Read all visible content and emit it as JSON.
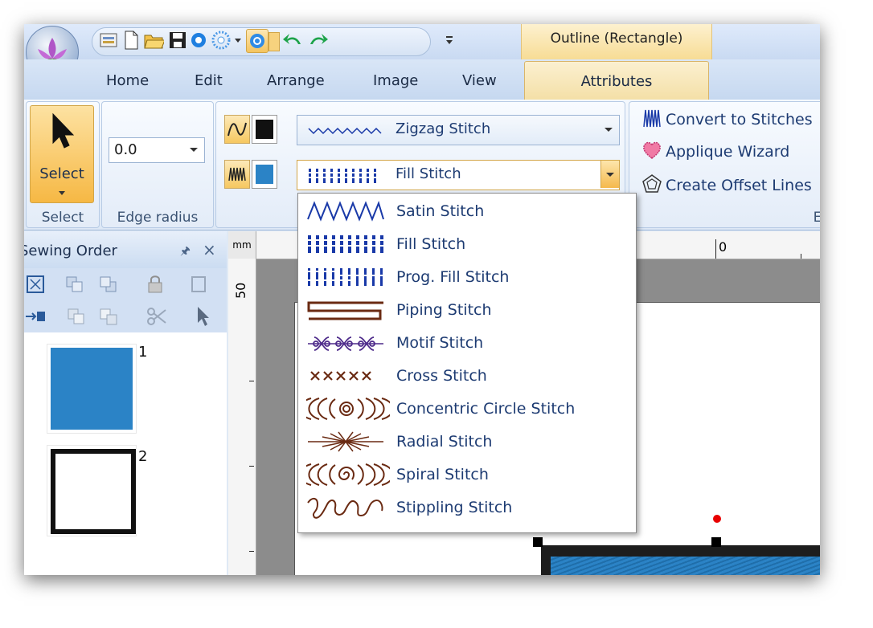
{
  "context_tab": {
    "title": "Outline (Rectangle)"
  },
  "tabs": [
    "Home",
    "Edit",
    "Arrange",
    "Image",
    "View",
    "Attributes"
  ],
  "ribbon": {
    "select": {
      "button_label": "Select",
      "group_label": "Select"
    },
    "edge_radius": {
      "value": "0.0",
      "group_label": "Edge radius"
    },
    "stitch": {
      "line_stitch_value": "Zigzag Stitch",
      "region_stitch_value": "Fill Stitch",
      "line_color": "#111111",
      "region_color": "#2b83c6"
    },
    "tools": {
      "convert_label": "Convert to Stitches",
      "applique_label": "Applique Wizard",
      "offset_label": "Create Offset Lines",
      "group_label_fragment": "E"
    }
  },
  "panel": {
    "title": "Sewing Order",
    "items": [
      {
        "number": "1"
      },
      {
        "number": "2"
      }
    ]
  },
  "ruler": {
    "unit": "mm",
    "h_label": "0",
    "v_label": "50"
  },
  "dropdown": {
    "items": [
      {
        "label": "Satin Stitch",
        "icon": "satin-stitch-icon"
      },
      {
        "label": "Fill Stitch",
        "icon": "fill-stitch-icon"
      },
      {
        "label": "Prog. Fill Stitch",
        "icon": "prog-fill-stitch-icon"
      },
      {
        "label": "Piping Stitch",
        "icon": "piping-stitch-icon"
      },
      {
        "label": "Motif Stitch",
        "icon": "motif-stitch-icon"
      },
      {
        "label": "Cross Stitch",
        "icon": "cross-stitch-icon"
      },
      {
        "label": "Concentric Circle Stitch",
        "icon": "concentric-circle-stitch-icon"
      },
      {
        "label": "Radial Stitch",
        "icon": "radial-stitch-icon"
      },
      {
        "label": "Spiral Stitch",
        "icon": "spiral-stitch-icon"
      },
      {
        "label": "Stippling Stitch",
        "icon": "stippling-stitch-icon"
      }
    ]
  }
}
